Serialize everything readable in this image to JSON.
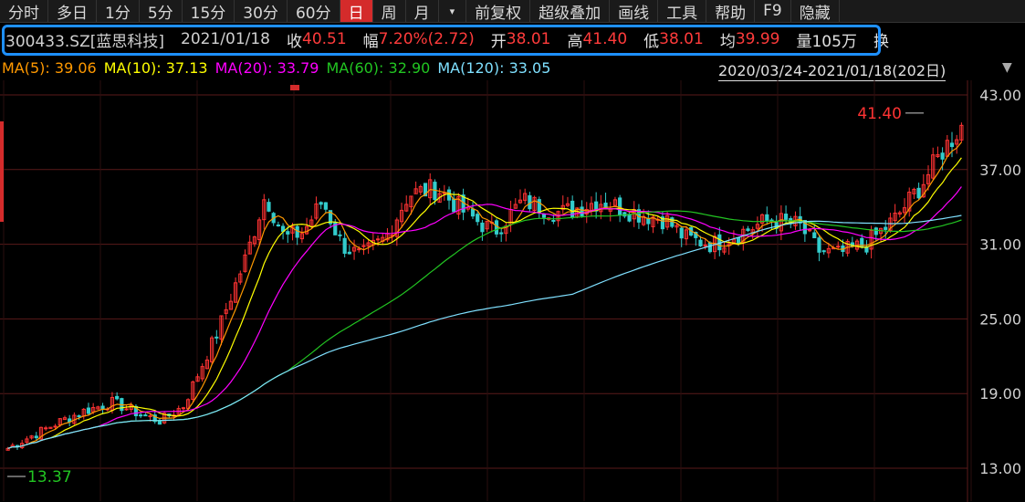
{
  "toolbar": {
    "items": [
      "分时",
      "多日",
      "1分",
      "5分",
      "15分",
      "30分",
      "60分",
      "日",
      "周",
      "月",
      "▾",
      "前复权",
      "超级叠加",
      "画线",
      "工具",
      "帮助",
      "F9",
      "隐藏"
    ],
    "active_index": 7
  },
  "info": {
    "code": "300433.SZ[蓝思科技]",
    "date": "2021/01/18",
    "close_label": "收",
    "close": "40.51",
    "change_label": "幅",
    "change": "7.20%(2.72)",
    "open_label": "开",
    "open": "38.01",
    "high_label": "高",
    "high": "41.40",
    "low_label": "低",
    "low": "38.01",
    "avg_label": "均",
    "avg": "39.99",
    "volume": "量105万",
    "turnover_label": "换"
  },
  "ma": [
    {
      "label": "MA(5): 39.06",
      "color": "#ff9900"
    },
    {
      "label": "MA(10): 37.13",
      "color": "#ffff00"
    },
    {
      "label": "MA(20): 33.79",
      "color": "#ff00ff"
    },
    {
      "label": "MA(60): 32.90",
      "color": "#22c522"
    },
    {
      "label": "MA(120): 33.05",
      "color": "#7fe0ff"
    }
  ],
  "range": "2020/03/24-2021/01/18(202日)",
  "chart_data": {
    "type": "candlestick",
    "y_ticks": [
      "43.00",
      "37.00",
      "31.00",
      "25.00",
      "19.00",
      "13.00"
    ],
    "ylim": [
      13,
      43
    ],
    "max_label": "41.40",
    "min_label": "13.37",
    "colors": {
      "up": "#ff3333",
      "down": "#33cccc",
      "grid": "#5a1a1a",
      "text": "#d0d0d0"
    }
  }
}
